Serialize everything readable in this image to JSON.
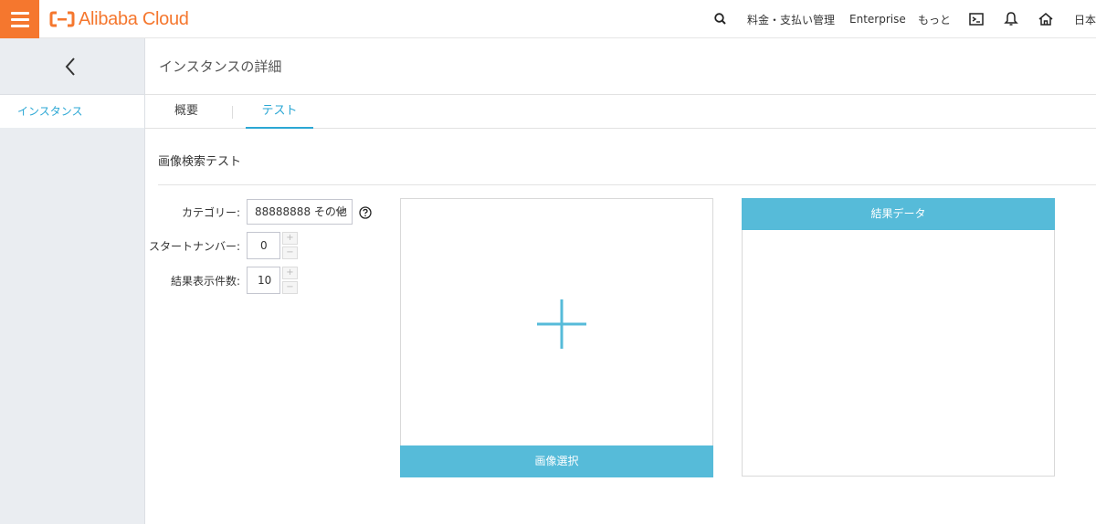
{
  "header": {
    "brand": "Alibaba Cloud",
    "nav": {
      "billing": "料金・支払い管理",
      "enterprise": "Enterprise",
      "more": "もっと",
      "language": "日本語"
    }
  },
  "sidebar": {
    "items": [
      {
        "label": "インスタンス"
      }
    ]
  },
  "main": {
    "page_title": "インスタンスの詳細",
    "tabs": [
      {
        "label": "概要"
      },
      {
        "label": "テスト"
      }
    ],
    "section_title": "画像検索テスト",
    "form": {
      "category_label": "カテゴリー:",
      "category_value": "88888888 その他",
      "start_number_label": "スタートナンバー:",
      "start_number_value": "0",
      "result_count_label": "結果表示件数:",
      "result_count_value": "10",
      "plus_symbol": "+",
      "minus_symbol": "−"
    },
    "upload": {
      "button_label": "画像選択"
    },
    "result": {
      "header_label": "結果データ"
    }
  },
  "colors": {
    "brand_orange": "#f5772e",
    "accent_blue": "#2ba7d4",
    "panel_blue": "#56bbd9"
  },
  "icons": {
    "menu": "hamburger-icon",
    "search": "search-icon",
    "console": "terminal-icon",
    "notifications": "bell-icon",
    "home": "home-icon",
    "back": "chevron-left-icon",
    "dropdown": "chevron-down-icon",
    "help": "question-circle-icon",
    "upload": "plus-icon"
  }
}
